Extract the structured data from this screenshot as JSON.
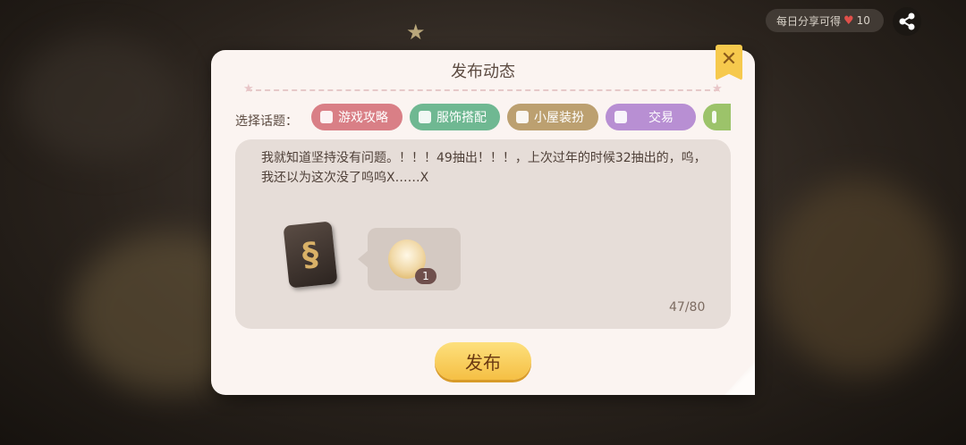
{
  "share": {
    "label": "每日分享可得",
    "reward": "10"
  },
  "dialog": {
    "title": "发布动态",
    "close_glyph": "✕",
    "topic_label": "选择话题：",
    "topics": [
      {
        "label": "游戏攻略",
        "color": "#d97f86"
      },
      {
        "label": "服饰搭配",
        "color": "#6fb892"
      },
      {
        "label": "小屋装扮",
        "color": "#bca070"
      },
      {
        "label": "交易",
        "color": "#b88fd3"
      },
      {
        "label": "",
        "color": "#9cc36a"
      }
    ],
    "post_text": "我就知道坚持没有问题。！！！49抽出！！！，上次过年的时候32抽出的，呜，我还以为这次没了呜呜X……X",
    "counter": "47/80",
    "attachment_quantity": "1",
    "publish_label": "发布"
  }
}
